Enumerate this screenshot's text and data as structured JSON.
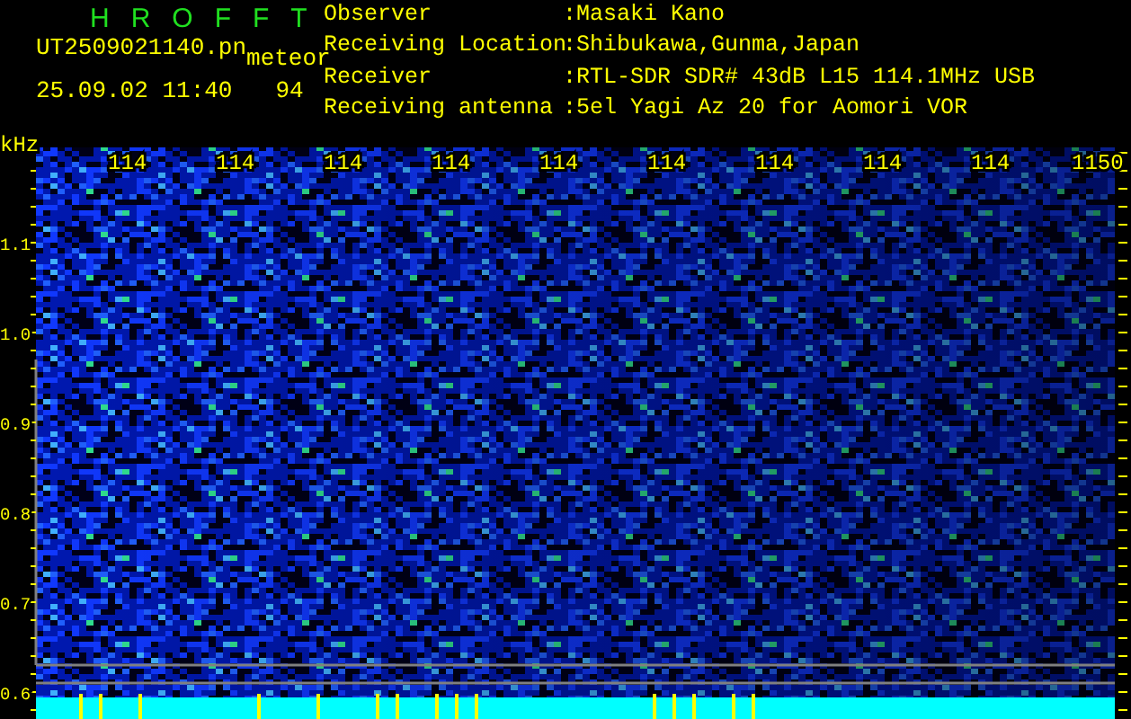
{
  "header": {
    "title": "HROFFT",
    "file_name": "UT2509021140.pn",
    "mode": "meteor",
    "timestamp": "25.09.02 11:40",
    "value": "94"
  },
  "info": [
    {
      "label": "Observer",
      "value": ":Masaki Kano"
    },
    {
      "label": "Receiving Location",
      "value": ":Shibukawa,Gunma,Japan"
    },
    {
      "label": "Receiver",
      "value": ":RTL-SDR SDR# 43dB L15 114.1MHz USB"
    },
    {
      "label": "Receiving antenna",
      "value": ":5el Yagi Az 20 for Aomori VOR"
    }
  ],
  "spectrogram": {
    "unit": "kHz",
    "x_labels": [
      "114",
      "114",
      "114",
      "114",
      "114",
      "114",
      "114",
      "114",
      "114",
      "1150"
    ],
    "y_labels": [
      "1.1",
      "1.0",
      "0.9",
      "0.8",
      "0.7",
      "0.6"
    ]
  }
}
